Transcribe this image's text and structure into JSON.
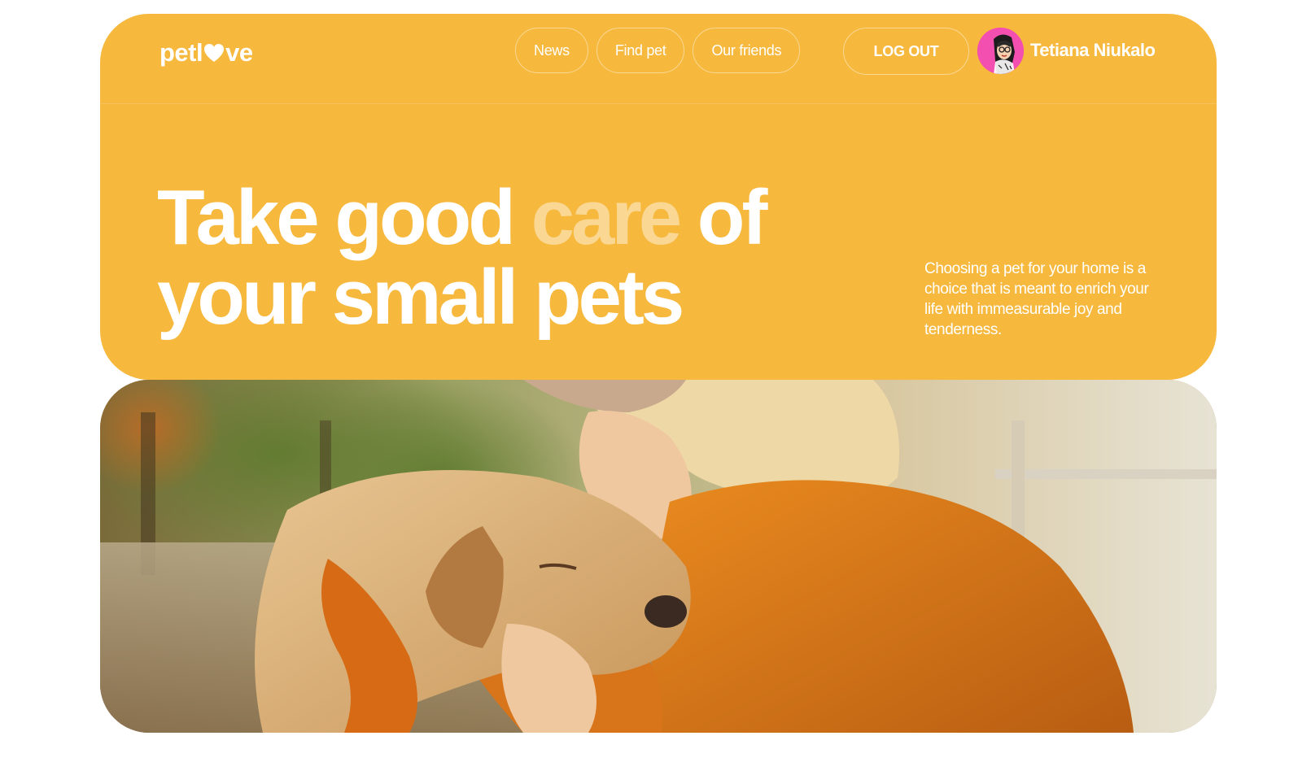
{
  "theme": {
    "accent": "#f6b83d",
    "text_on_accent": "#ffffff",
    "avatar_bg": "#f34fb0"
  },
  "header": {
    "logo": {
      "part1": "petl",
      "heart_icon": "heart-icon",
      "part2": "ve"
    },
    "nav": [
      {
        "label": "News"
      },
      {
        "label": "Find pet"
      },
      {
        "label": "Our friends"
      }
    ],
    "logout_label": "LOG OUT",
    "user": {
      "name": "Tetiana Niukalo",
      "avatar_icon": "user-avatar"
    }
  },
  "hero": {
    "headline": {
      "before": "Take good ",
      "highlight": "care",
      "after": " of",
      "line2": "your small pets"
    },
    "intro": "Choosing a pet for your home is a choice that is meant to enrich your life with immeasurable joy and tenderness."
  },
  "photo": {
    "icon": "woman-kissing-dog-photo"
  }
}
